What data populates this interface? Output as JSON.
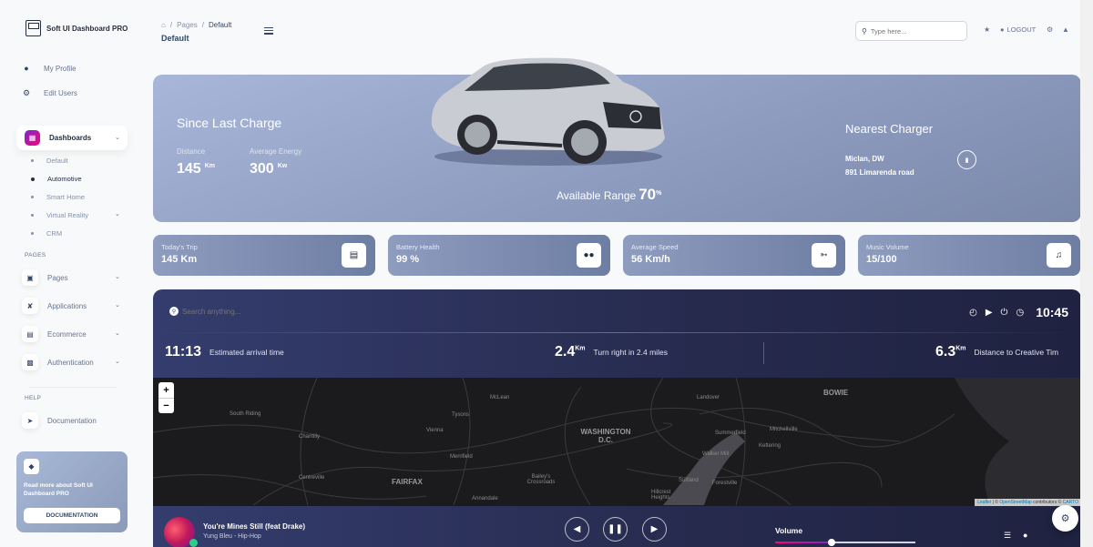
{
  "brand": {
    "name": "Soft UI Dashboard PRO"
  },
  "sidebar": {
    "top_items": [
      {
        "label": "My Profile",
        "icon": "user-icon"
      },
      {
        "label": "Edit Users",
        "icon": "gear-icon"
      }
    ],
    "dashboards": {
      "label": "Dashboards",
      "icon": "shop-icon",
      "accent": "#cb0c9f",
      "children": [
        {
          "label": "Default",
          "active": false
        },
        {
          "label": "Automotive",
          "active": true
        },
        {
          "label": "Smart Home",
          "active": false
        },
        {
          "label": "Virtual Reality",
          "active": false,
          "has_children": true
        },
        {
          "label": "CRM",
          "active": false
        }
      ]
    },
    "pages_heading": "PAGES",
    "pages": [
      {
        "label": "Pages",
        "icon": "office-icon"
      },
      {
        "label": "Applications",
        "icon": "tools-icon"
      },
      {
        "label": "Ecommerce",
        "icon": "basket-icon"
      },
      {
        "label": "Authentication",
        "icon": "document-icon"
      }
    ],
    "help_heading": "HELP",
    "help_items": [
      {
        "label": "Documentation",
        "icon": "rocket-icon"
      }
    ],
    "help_card": {
      "text": "Read more about Soft UI Dashboard PRO",
      "button": "DOCUMENTATION",
      "icon": "diamond-icon"
    }
  },
  "topbar": {
    "breadcrumb": [
      "Pages",
      "Default"
    ],
    "title": "Default",
    "search_placeholder": "Type here...",
    "logout_label": "LOGOUT"
  },
  "hero": {
    "title": "Since Last Charge",
    "stats": [
      {
        "label": "Distance",
        "value": "145",
        "unit": "Km"
      },
      {
        "label": "Average Energy",
        "value": "300",
        "unit": "Kw"
      }
    ],
    "range_label": "Available Range",
    "range_value": "70",
    "range_unit": "%",
    "charger_title": "Nearest Charger",
    "charger_city": "Miclan, DW",
    "charger_address": "891 Limarenda road"
  },
  "mini_cards": [
    {
      "label": "Today's Trip",
      "value": "145 Km",
      "icon": "map-icon"
    },
    {
      "label": "Battery Health",
      "value": "99 %",
      "icon": "battery-icon"
    },
    {
      "label": "Average Speed",
      "value": "56 Km/h",
      "icon": "speed-icon"
    },
    {
      "label": "Music Volume",
      "value": "15/100",
      "icon": "music-note-icon"
    }
  ],
  "nav_panel": {
    "search_placeholder": "Search anything...",
    "time": "10:45",
    "arrival_time": "11:13",
    "arrival_label": "Estimated arrival time",
    "turn_distance": "2.4",
    "turn_unit": "Km",
    "turn_label": "Turn right in 2.4 miles",
    "dest_distance": "6.3",
    "dest_unit": "Km",
    "dest_label": "Distance to Creative Tim"
  },
  "map": {
    "zoom_in": "+",
    "zoom_out": "−",
    "cities": [
      "South Riding",
      "Chantilly",
      "Centreville",
      "Tysons",
      "McLean",
      "Vienna",
      "Merrifield",
      "Annandale",
      "Bailey's Crossroads",
      "FAIRFAX",
      "WASHINGTON D.C.",
      "Landover",
      "Summerfield",
      "Mitchellville",
      "Kettering",
      "Walker Mill",
      "Suitland",
      "Forestville",
      "Hillcrest Heights",
      "BOWIE"
    ],
    "attribution_leaflet": "Leaflet",
    "attribution_osm": "OpenStreetMap",
    "attribution_text": "contributors ©",
    "attribution_carto": "CARTO"
  },
  "player": {
    "song": "You're Mines Still (feat Drake)",
    "artist": "Yung Bleu - Hip-Hop",
    "volume_label": "Volume",
    "volume_percent": 40
  }
}
